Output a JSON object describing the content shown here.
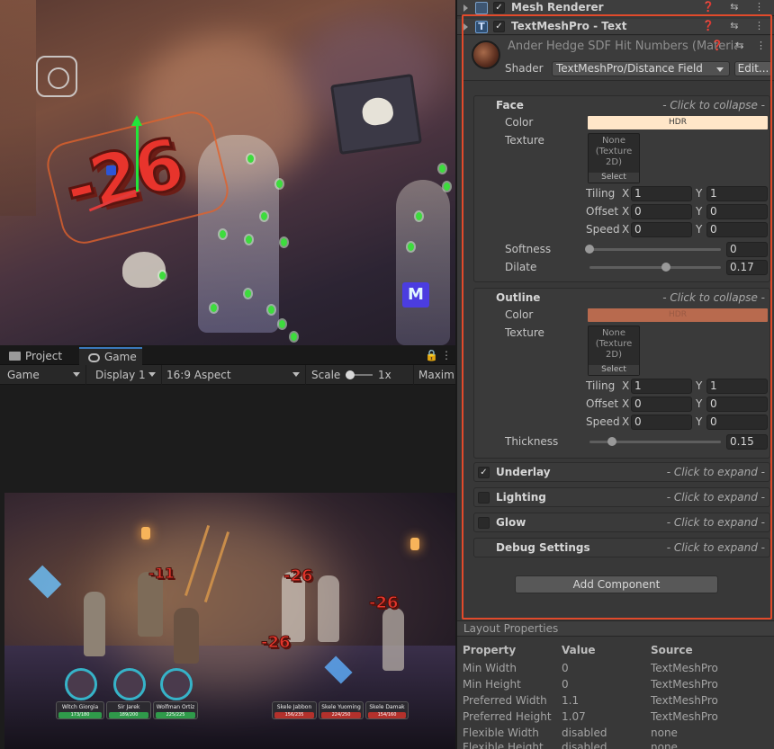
{
  "inspector": {
    "mesh_renderer": {
      "title": "Mesh Renderer",
      "enabled": true,
      "icons": "❓ ⇆ ⋮"
    },
    "tmp": {
      "title": "TextMeshPro - Text",
      "enabled": true,
      "icons": "❓ ⇆ ⋮",
      "material_name": "Ander Hedge SDF Hit Numbers (Material)",
      "material_icons": "❓ ⇆ ⋮",
      "shader_label": "Shader",
      "shader_value": "TextMeshPro/Distance Field",
      "edit_label": "Edit..."
    },
    "face": {
      "title": "Face",
      "hint": "- Click to collapse -",
      "color_label": "Color",
      "color_text": "HDR",
      "color_value": "#ffe6c8",
      "texture_label": "Texture",
      "texture_slot": "None\n(Texture\n2D)",
      "select_label": "Select",
      "tiling_label": "Tiling",
      "tiling_x": "1",
      "tiling_y": "1",
      "offset_label": "Offset",
      "offset_x": "0",
      "offset_y": "0",
      "speed_label": "Speed",
      "speed_x": "0",
      "speed_y": "0",
      "softness_label": "Softness",
      "softness_value": "0",
      "softness_frac": 0.0,
      "dilate_label": "Dilate",
      "dilate_value": "0.17",
      "dilate_frac": 0.585
    },
    "outline": {
      "title": "Outline",
      "hint": "- Click to collapse -",
      "color_label": "Color",
      "color_text": "HDR",
      "color_value": "#b86a4e",
      "texture_label": "Texture",
      "texture_slot": "None\n(Texture\n2D)",
      "select_label": "Select",
      "tiling_label": "Tiling",
      "tiling_x": "1",
      "tiling_y": "1",
      "offset_label": "Offset",
      "offset_x": "0",
      "offset_y": "0",
      "speed_label": "Speed",
      "speed_x": "0",
      "speed_y": "0",
      "thickness_label": "Thickness",
      "thickness_value": "0.15",
      "thickness_frac": 0.17
    },
    "axis_x": "X",
    "axis_y": "Y",
    "underlay": {
      "title": "Underlay",
      "hint": "- Click to expand -",
      "checked": true
    },
    "lighting": {
      "title": "Lighting",
      "hint": "- Click to expand -",
      "checked": false
    },
    "glow": {
      "title": "Glow",
      "hint": "- Click to expand -",
      "checked": false
    },
    "debug": {
      "title": "Debug Settings",
      "hint": "- Click to expand -"
    },
    "add_component": "Add Component",
    "layout_properties": {
      "title": "Layout Properties",
      "headers": [
        "Property",
        "Value",
        "Source"
      ],
      "rows": [
        [
          "Min Width",
          "0",
          "TextMeshPro"
        ],
        [
          "Min Height",
          "0",
          "TextMeshPro"
        ],
        [
          "Preferred Width",
          "1.1",
          "TextMeshPro"
        ],
        [
          "Preferred Height",
          "1.07",
          "TextMeshPro"
        ],
        [
          "Flexible Width",
          "disabled",
          "none"
        ],
        [
          "Flexible Height",
          "disabled",
          "none"
        ]
      ]
    }
  },
  "game_panel": {
    "tabs": [
      "Project",
      "Game"
    ],
    "active_tab": "Game",
    "toolbar": {
      "mode": "Game",
      "display": "Display 1",
      "aspect": "16:9 Aspect",
      "scale_label": "Scale",
      "scale_value": "1x",
      "maximize": "Maximi"
    }
  },
  "scene": {
    "hit_number": "-26"
  },
  "game_view": {
    "damage_numbers": [
      "-11",
      "-26",
      "-26",
      "-26"
    ],
    "heroes": [
      {
        "name": "Witch Giorgia",
        "hp": "173/180"
      },
      {
        "name": "Sir Jarek",
        "hp": "189/200"
      },
      {
        "name": "Wolfman Ortiz",
        "hp": "225/225"
      }
    ],
    "enemies": [
      {
        "name": "Skele Jabbon",
        "hp": "156/235"
      },
      {
        "name": "Skele Yuoming",
        "hp": "224/250"
      },
      {
        "name": "Skele Damak",
        "hp": "154/160"
      }
    ]
  }
}
